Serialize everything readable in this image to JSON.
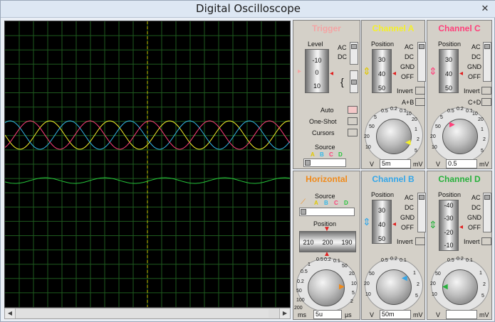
{
  "window": {
    "title": "Digital Oscilloscope",
    "close_glyph": "✕"
  },
  "colors": {
    "A": "#f5f02a",
    "B": "#34b8e8",
    "C": "#ff3f7a",
    "D": "#26c43b",
    "grid": "#1e5a1e",
    "marker": "#c8c800"
  },
  "trigger": {
    "title": "Trigger",
    "title_color": "#f4a4a4",
    "level_label": "Level",
    "level_ticks": [
      "-10",
      "0",
      "10"
    ],
    "ac": "AC",
    "dc": "DC",
    "modes": [
      "Auto",
      "One-Shot",
      "Cursors"
    ],
    "source_label": "Source",
    "sources": [
      "A",
      "B",
      "C",
      "D"
    ]
  },
  "channel_a": {
    "title": "Channel A",
    "title_color": "#f5f02a",
    "position_label": "Position",
    "ticks": [
      "30",
      "40",
      "50"
    ],
    "coupling": [
      "AC",
      "DC",
      "GND",
      "OFF"
    ],
    "invert": "Invert",
    "combine": "A+B",
    "dial_scale": [
      "0.5",
      "0.2",
      "0.1",
      "50",
      "20",
      "10",
      "5",
      "2",
      "1",
      "20",
      "10",
      "5"
    ],
    "unit_left": "V",
    "value": "5m",
    "unit_right": "mV"
  },
  "channel_c": {
    "title": "Channel C",
    "title_color": "#ff3f7a",
    "position_label": "Position",
    "ticks": [
      "30",
      "40",
      "50"
    ],
    "coupling": [
      "AC",
      "DC",
      "GND",
      "OFF"
    ],
    "invert": "Invert",
    "combine": "C+D",
    "dial_scale": [
      "0.5",
      "0.2",
      "0.1",
      "50",
      "20",
      "10",
      "5",
      "2",
      "1",
      "20",
      "10",
      "5"
    ],
    "unit_left": "V",
    "value": "0.5",
    "unit_right": "mV"
  },
  "horizontal": {
    "title": "Horizontal",
    "title_color": "#f08a1a",
    "source_label": "Source",
    "sources": [
      "A",
      "B",
      "C",
      "D"
    ],
    "position_label": "Position",
    "ticks": [
      "210",
      "200",
      "190"
    ],
    "dial_scale": [
      "0.5",
      "0.2",
      "0.1",
      "50",
      "20",
      "10",
      "5",
      "2",
      "1",
      "0.5",
      "0.2",
      "200",
      "100",
      "50"
    ],
    "unit_left": "ms",
    "value": "5u",
    "unit_right": "µs"
  },
  "channel_b": {
    "title": "Channel B",
    "title_color": "#34a6e8",
    "position_label": "Position",
    "ticks": [
      "30",
      "40",
      "50"
    ],
    "coupling": [
      "AC",
      "DC",
      "GND",
      "OFF"
    ],
    "invert": "Invert",
    "dial_scale": [
      "0.5",
      "0.2",
      "0.1",
      "50",
      "20",
      "10",
      "5",
      "2",
      "1"
    ],
    "unit_left": "V",
    "value": "50m",
    "unit_right": "mV"
  },
  "channel_d": {
    "title": "Channel D",
    "title_color": "#26b03b",
    "position_label": "Position",
    "ticks": [
      "-40",
      "-30",
      "-20",
      "-10"
    ],
    "coupling": [
      "AC",
      "DC",
      "GND",
      "OFF"
    ],
    "invert": "Invert",
    "dial_scale": [
      "0.5",
      "0.2",
      "0.1",
      "50",
      "20",
      "10",
      "5",
      "2",
      "1"
    ],
    "unit_left": "V",
    "value": "",
    "unit_right": "mV"
  },
  "scrollbar": {
    "left": "◀",
    "right": "▶"
  }
}
